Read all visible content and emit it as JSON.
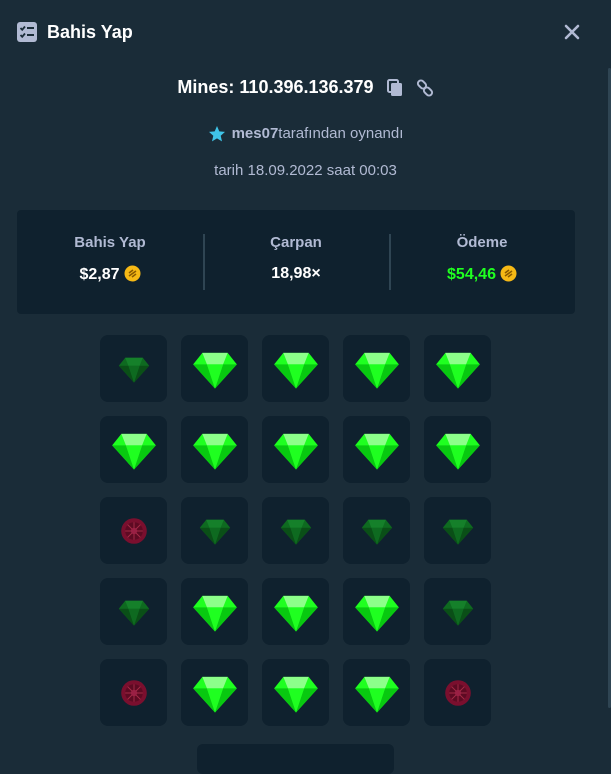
{
  "header": {
    "title": "Bahis Yap"
  },
  "game": {
    "label": "Mines: 110.396.136.379"
  },
  "player": {
    "name": "mes07",
    "suffix": "tarafından oynandı"
  },
  "date": {
    "prefix": "tarih",
    "date": "18.09.2022",
    "time_prefix": "saat",
    "time": "00:03"
  },
  "stats": {
    "bet_label": "Bahis Yap",
    "bet_value": "$2,87",
    "multiplier_label": "Çarpan",
    "multiplier_value": "18,98×",
    "payout_label": "Ödeme",
    "payout_value": "$54,46"
  },
  "colors": {
    "gem_revealed": "#1fff20",
    "gem_dim": "#0f6b1e",
    "mine": "#7a0f2e",
    "payout": "#1fff20",
    "coin": "#f6b915"
  },
  "grid": {
    "rows": 5,
    "cols": 5,
    "tiles": [
      "gem-dim",
      "gem",
      "gem",
      "gem",
      "gem",
      "gem",
      "gem",
      "gem",
      "gem",
      "gem",
      "mine-dim",
      "gem-dim",
      "gem-dim",
      "gem-dim",
      "gem-dim",
      "gem-dim",
      "gem",
      "gem",
      "gem",
      "gem-dim",
      "mine-dim",
      "gem",
      "gem",
      "gem",
      "mine-dim"
    ]
  }
}
